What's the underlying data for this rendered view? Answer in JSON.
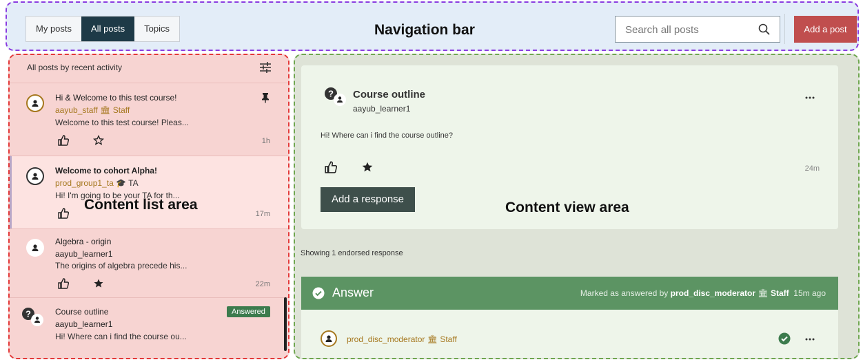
{
  "nav": {
    "tabs": [
      {
        "label": "My posts",
        "active": false
      },
      {
        "label": "All posts",
        "active": true
      },
      {
        "label": "Topics",
        "active": false
      }
    ],
    "region_label": "Navigation bar",
    "search_placeholder": "Search all posts",
    "add_post_label": "Add a post"
  },
  "list": {
    "header_label": "All posts by recent activity",
    "region_label": "Content list area",
    "posts": [
      {
        "title": "Hi & Welcome to this test course!",
        "author": "aayub_staff",
        "role": "Staff",
        "snippet": "Welcome to this test course! Pleas...",
        "time": "1h",
        "pinned": true
      },
      {
        "title": "Welcome to cohort Alpha!",
        "author": "prod_group1_ta",
        "role": "TA",
        "snippet": "Hi! I'm going to be your TA for th...",
        "time": "17m"
      },
      {
        "title": "Algebra - origin",
        "author": "aayub_learner1",
        "snippet": "The origins of algebra precede his...",
        "time": "22m"
      },
      {
        "title": "Course outline",
        "author": "aayub_learner1",
        "snippet": "Hi! Where can i find the course ou...",
        "badge": "Answered"
      }
    ]
  },
  "view": {
    "region_label": "Content view area",
    "title": "Course outline",
    "author": "aayub_learner1",
    "body": "Hi! Where can i find the course outline?",
    "time": "24m",
    "add_response_label": "Add a response",
    "endorsed_label": "Showing 1 endorsed response",
    "answer": {
      "title": "Answer",
      "meta_prefix": "Marked as answered by",
      "moderator": "prod_disc_moderator",
      "role": "Staff",
      "time": "15m ago"
    },
    "response": {
      "author": "prod_disc_moderator",
      "role": "Staff"
    }
  },
  "colors": {
    "nav_bg": "#e3edf8",
    "list_bg": "#f7d4d2",
    "view_bg": "#dee3d7",
    "active_tab": "#1e3a47",
    "add_post": "#c04e4e",
    "answer_bar": "#5c9463",
    "staff": "#a6781f"
  }
}
